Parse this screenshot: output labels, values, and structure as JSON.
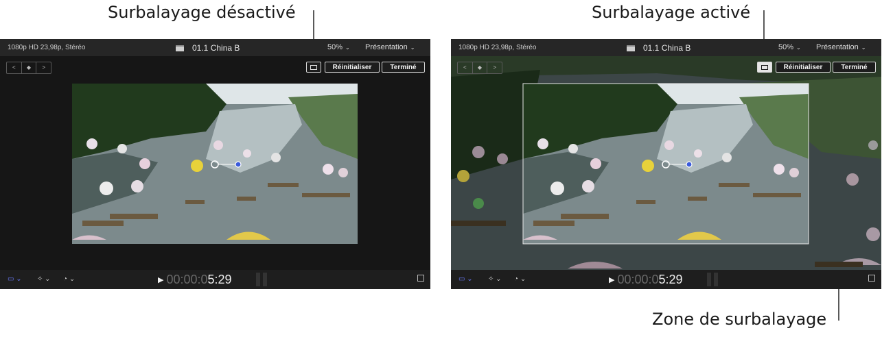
{
  "callouts": {
    "off": "Surbalayage désactivé",
    "on": "Surbalayage activé",
    "zone": "Zone de surbalayage"
  },
  "viewer": {
    "format": "1080p HD 23,98p, Stéréo",
    "clip_name": "01.1 China B",
    "zoom": "50%",
    "presentation": "Présentation",
    "chevron": "⌄",
    "reset_label": "Réinitialiser",
    "done_label": "Terminé",
    "nav_prev": "<",
    "nav_keyframe": "◆",
    "nav_next": ">",
    "timecode_dim": "00:00:0",
    "timecode_bright": "5:29",
    "play_glyph": "▶"
  },
  "icons": {
    "transform": "transform-icon",
    "enhance": "magic-wand-icon",
    "speed": "speedometer-icon",
    "expand": "expand-icon",
    "clapper": "clapper-icon",
    "overscan": "overscan-icon"
  }
}
